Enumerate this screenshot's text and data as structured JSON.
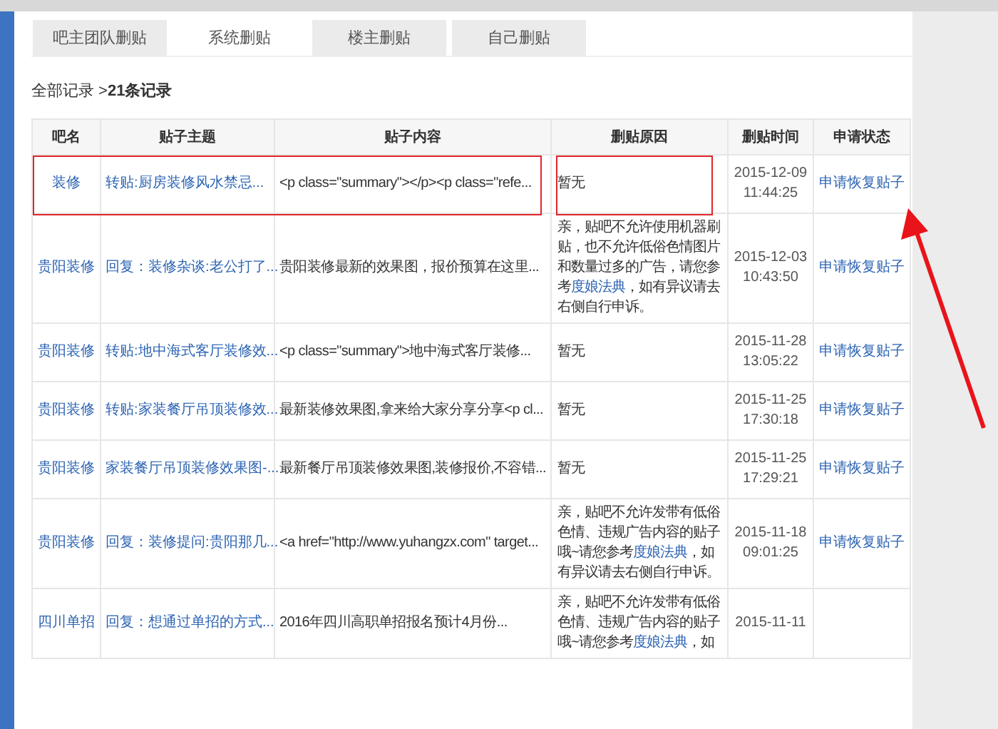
{
  "tabs": [
    {
      "label": "吧主团队删贴",
      "selected": false
    },
    {
      "label": "系统删贴",
      "selected": true
    },
    {
      "label": "楼主删贴",
      "selected": false
    },
    {
      "label": "自己删贴",
      "selected": false
    }
  ],
  "breadcrumb": {
    "prefix": "全部记录 >",
    "count": "21条记录"
  },
  "table": {
    "columns": [
      "吧名",
      "贴子主题",
      "贴子内容",
      "删贴原因",
      "删贴时间",
      "申请状态"
    ],
    "rows": [
      {
        "forum": "装修",
        "title": "转贴:厨房装修风水禁忌...",
        "content": "<p class=\"summary\"></p><p class=\"refe...",
        "reason": [
          {
            "kind": "text",
            "text": "暂无"
          }
        ],
        "date": "2015-12-09",
        "time": "11:44:25",
        "action": "申请恢复贴子"
      },
      {
        "forum": "贵阳装修",
        "title": "回复：装修杂谈:老公打了...",
        "content": "贵阳装修最新的效果图，报价预算在这里...",
        "reason": [
          {
            "kind": "text",
            "text": "亲，贴吧不允许使用机器刷贴，也不允许低俗色情图片和数量过多的广告，请您参考"
          },
          {
            "kind": "link",
            "text": "度娘法典"
          },
          {
            "kind": "text",
            "text": "，如有异议请去右侧自行申诉。"
          }
        ],
        "date": "2015-12-03",
        "time": "10:43:50",
        "action": "申请恢复贴子"
      },
      {
        "forum": "贵阳装修",
        "title": "转贴:地中海式客厅装修效...",
        "content": "<p class=\"summary\">地中海式客厅装修...",
        "reason": [
          {
            "kind": "text",
            "text": "暂无"
          }
        ],
        "date": "2015-11-28",
        "time": "13:05:22",
        "action": "申请恢复贴子"
      },
      {
        "forum": "贵阳装修",
        "title": "转贴:家装餐厅吊顶装修效...",
        "content": "最新装修效果图,拿来给大家分享分享<p cl...",
        "reason": [
          {
            "kind": "text",
            "text": "暂无"
          }
        ],
        "date": "2015-11-25",
        "time": "17:30:18",
        "action": "申请恢复贴子"
      },
      {
        "forum": "贵阳装修",
        "title": "家装餐厅吊顶装修效果图-...",
        "content": "最新餐厅吊顶装修效果图,装修报价,不容错...",
        "reason": [
          {
            "kind": "text",
            "text": "暂无"
          }
        ],
        "date": "2015-11-25",
        "time": "17:29:21",
        "action": "申请恢复贴子"
      },
      {
        "forum": "贵阳装修",
        "title": "回复：装修提问:贵阳那几...",
        "content": "<a href=\"http://www.yuhangzx.com\" target...",
        "reason": [
          {
            "kind": "text",
            "text": "亲，贴吧不允许发带有低俗色情、违规广告内容的贴子哦~请您参考"
          },
          {
            "kind": "link",
            "text": "度娘法典"
          },
          {
            "kind": "text",
            "text": "，如有异议请去右侧自行申诉。"
          }
        ],
        "date": "2015-11-18",
        "time": "09:01:25",
        "action": "申请恢复贴子"
      },
      {
        "forum": "四川单招",
        "title": "回复：想通过单招的方式...",
        "content": "2016年四川高职单招报名预计4月份...",
        "reason": [
          {
            "kind": "text",
            "text": "亲，贴吧不允许发带有低俗色情、违规广告内容的贴子哦~请您参考"
          },
          {
            "kind": "link",
            "text": "度娘法典"
          },
          {
            "kind": "text",
            "text": "，如"
          }
        ],
        "date": "2015-11-11",
        "time": "",
        "action": ""
      }
    ]
  }
}
